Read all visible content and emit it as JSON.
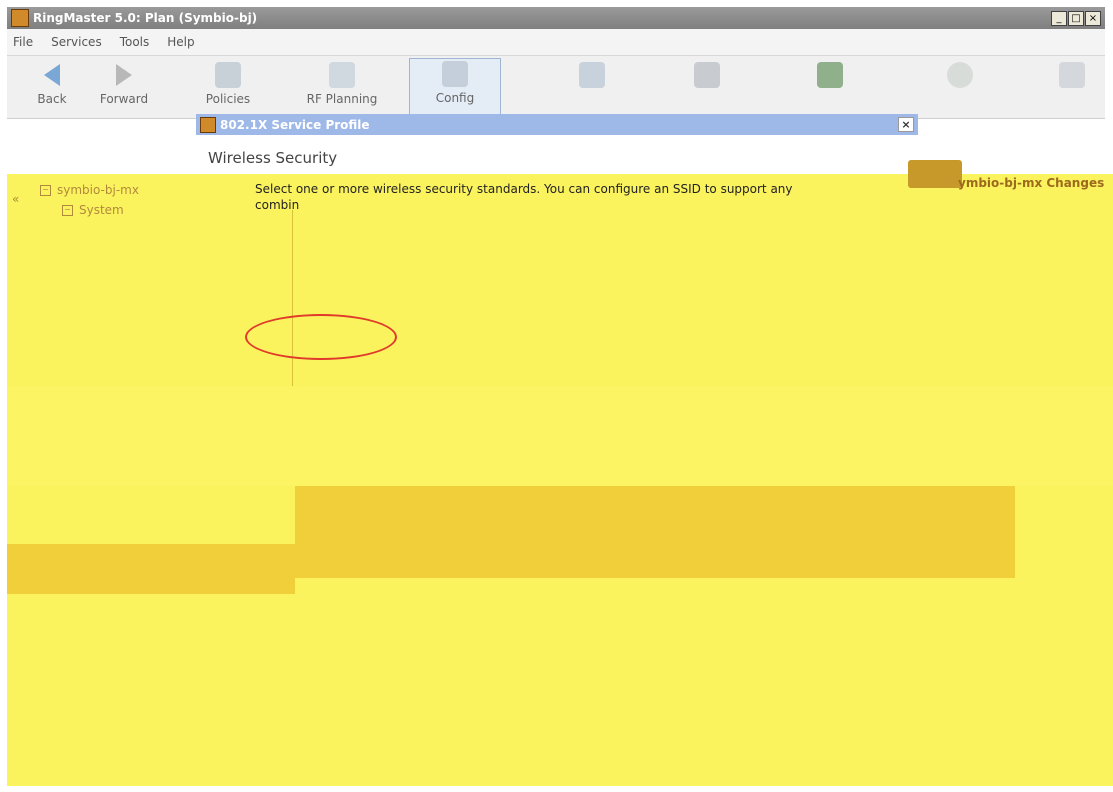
{
  "window": {
    "title": "RingMaster 5.0: Plan (Symbio-bj)",
    "controls": [
      "_",
      "□",
      "×"
    ]
  },
  "menu": [
    {
      "label": "File"
    },
    {
      "label": "Services"
    },
    {
      "label": "Tools"
    },
    {
      "label": "Help"
    }
  ],
  "toolbar": {
    "back_label": "Back",
    "forward_label": "Forward",
    "policies_label": "Policies",
    "rf_planning_label": "RF Planning",
    "configure_label": "Config"
  },
  "dialog": {
    "title": "802.1X Service Profile",
    "close": "×",
    "heading": "Wireless Security",
    "description": "Select one or more wireless security standards. You can configure an SSID to support any combin"
  },
  "tree": {
    "root": "symbio-bj-mx",
    "child": "System"
  },
  "changes": {
    "label": "ymbio-bj-mx Changes"
  },
  "colors": {
    "title_bar": "#8c8c8c",
    "dialog_title": "#9eb8e8",
    "yellow_overlay": "#fbf35e",
    "highlight": "#e03a2a"
  }
}
